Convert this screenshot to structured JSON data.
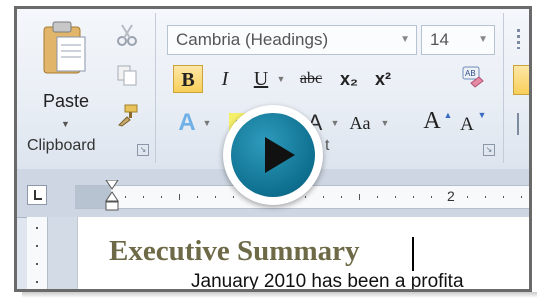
{
  "clipboard": {
    "paste_label": "Paste",
    "group_label": "Clipboard"
  },
  "font": {
    "font_name": "Cambria (Headings)",
    "font_size": "14",
    "bold": "B",
    "italic": "I",
    "underline": "U",
    "strikethrough": "abc",
    "subscript": "x₂",
    "superscript": "x²",
    "change_case": "Aa",
    "grow_font": "A",
    "shrink_font": "A",
    "group_label_partial": "t"
  },
  "ruler": {
    "mark": "2"
  },
  "document": {
    "heading": "Executive Summary",
    "body_line": "January 2010  has been a profita"
  },
  "colors": {
    "accent": "#0e6f8f",
    "heading_color": "#6e6a47"
  }
}
